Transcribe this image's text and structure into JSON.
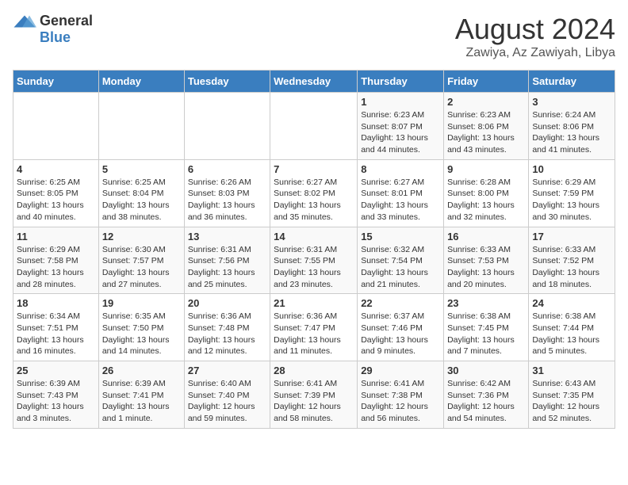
{
  "header": {
    "logo_general": "General",
    "logo_blue": "Blue",
    "month_title": "August 2024",
    "location": "Zawiya, Az Zawiyah, Libya"
  },
  "days_of_week": [
    "Sunday",
    "Monday",
    "Tuesday",
    "Wednesday",
    "Thursday",
    "Friday",
    "Saturday"
  ],
  "weeks": [
    [
      {
        "day": "",
        "info": ""
      },
      {
        "day": "",
        "info": ""
      },
      {
        "day": "",
        "info": ""
      },
      {
        "day": "",
        "info": ""
      },
      {
        "day": "1",
        "info": "Sunrise: 6:23 AM\nSunset: 8:07 PM\nDaylight: 13 hours\nand 44 minutes."
      },
      {
        "day": "2",
        "info": "Sunrise: 6:23 AM\nSunset: 8:06 PM\nDaylight: 13 hours\nand 43 minutes."
      },
      {
        "day": "3",
        "info": "Sunrise: 6:24 AM\nSunset: 8:06 PM\nDaylight: 13 hours\nand 41 minutes."
      }
    ],
    [
      {
        "day": "4",
        "info": "Sunrise: 6:25 AM\nSunset: 8:05 PM\nDaylight: 13 hours\nand 40 minutes."
      },
      {
        "day": "5",
        "info": "Sunrise: 6:25 AM\nSunset: 8:04 PM\nDaylight: 13 hours\nand 38 minutes."
      },
      {
        "day": "6",
        "info": "Sunrise: 6:26 AM\nSunset: 8:03 PM\nDaylight: 13 hours\nand 36 minutes."
      },
      {
        "day": "7",
        "info": "Sunrise: 6:27 AM\nSunset: 8:02 PM\nDaylight: 13 hours\nand 35 minutes."
      },
      {
        "day": "8",
        "info": "Sunrise: 6:27 AM\nSunset: 8:01 PM\nDaylight: 13 hours\nand 33 minutes."
      },
      {
        "day": "9",
        "info": "Sunrise: 6:28 AM\nSunset: 8:00 PM\nDaylight: 13 hours\nand 32 minutes."
      },
      {
        "day": "10",
        "info": "Sunrise: 6:29 AM\nSunset: 7:59 PM\nDaylight: 13 hours\nand 30 minutes."
      }
    ],
    [
      {
        "day": "11",
        "info": "Sunrise: 6:29 AM\nSunset: 7:58 PM\nDaylight: 13 hours\nand 28 minutes."
      },
      {
        "day": "12",
        "info": "Sunrise: 6:30 AM\nSunset: 7:57 PM\nDaylight: 13 hours\nand 27 minutes."
      },
      {
        "day": "13",
        "info": "Sunrise: 6:31 AM\nSunset: 7:56 PM\nDaylight: 13 hours\nand 25 minutes."
      },
      {
        "day": "14",
        "info": "Sunrise: 6:31 AM\nSunset: 7:55 PM\nDaylight: 13 hours\nand 23 minutes."
      },
      {
        "day": "15",
        "info": "Sunrise: 6:32 AM\nSunset: 7:54 PM\nDaylight: 13 hours\nand 21 minutes."
      },
      {
        "day": "16",
        "info": "Sunrise: 6:33 AM\nSunset: 7:53 PM\nDaylight: 13 hours\nand 20 minutes."
      },
      {
        "day": "17",
        "info": "Sunrise: 6:33 AM\nSunset: 7:52 PM\nDaylight: 13 hours\nand 18 minutes."
      }
    ],
    [
      {
        "day": "18",
        "info": "Sunrise: 6:34 AM\nSunset: 7:51 PM\nDaylight: 13 hours\nand 16 minutes."
      },
      {
        "day": "19",
        "info": "Sunrise: 6:35 AM\nSunset: 7:50 PM\nDaylight: 13 hours\nand 14 minutes."
      },
      {
        "day": "20",
        "info": "Sunrise: 6:36 AM\nSunset: 7:48 PM\nDaylight: 13 hours\nand 12 minutes."
      },
      {
        "day": "21",
        "info": "Sunrise: 6:36 AM\nSunset: 7:47 PM\nDaylight: 13 hours\nand 11 minutes."
      },
      {
        "day": "22",
        "info": "Sunrise: 6:37 AM\nSunset: 7:46 PM\nDaylight: 13 hours\nand 9 minutes."
      },
      {
        "day": "23",
        "info": "Sunrise: 6:38 AM\nSunset: 7:45 PM\nDaylight: 13 hours\nand 7 minutes."
      },
      {
        "day": "24",
        "info": "Sunrise: 6:38 AM\nSunset: 7:44 PM\nDaylight: 13 hours\nand 5 minutes."
      }
    ],
    [
      {
        "day": "25",
        "info": "Sunrise: 6:39 AM\nSunset: 7:43 PM\nDaylight: 13 hours\nand 3 minutes."
      },
      {
        "day": "26",
        "info": "Sunrise: 6:39 AM\nSunset: 7:41 PM\nDaylight: 13 hours\nand 1 minute."
      },
      {
        "day": "27",
        "info": "Sunrise: 6:40 AM\nSunset: 7:40 PM\nDaylight: 12 hours\nand 59 minutes."
      },
      {
        "day": "28",
        "info": "Sunrise: 6:41 AM\nSunset: 7:39 PM\nDaylight: 12 hours\nand 58 minutes."
      },
      {
        "day": "29",
        "info": "Sunrise: 6:41 AM\nSunset: 7:38 PM\nDaylight: 12 hours\nand 56 minutes."
      },
      {
        "day": "30",
        "info": "Sunrise: 6:42 AM\nSunset: 7:36 PM\nDaylight: 12 hours\nand 54 minutes."
      },
      {
        "day": "31",
        "info": "Sunrise: 6:43 AM\nSunset: 7:35 PM\nDaylight: 12 hours\nand 52 minutes."
      }
    ]
  ]
}
